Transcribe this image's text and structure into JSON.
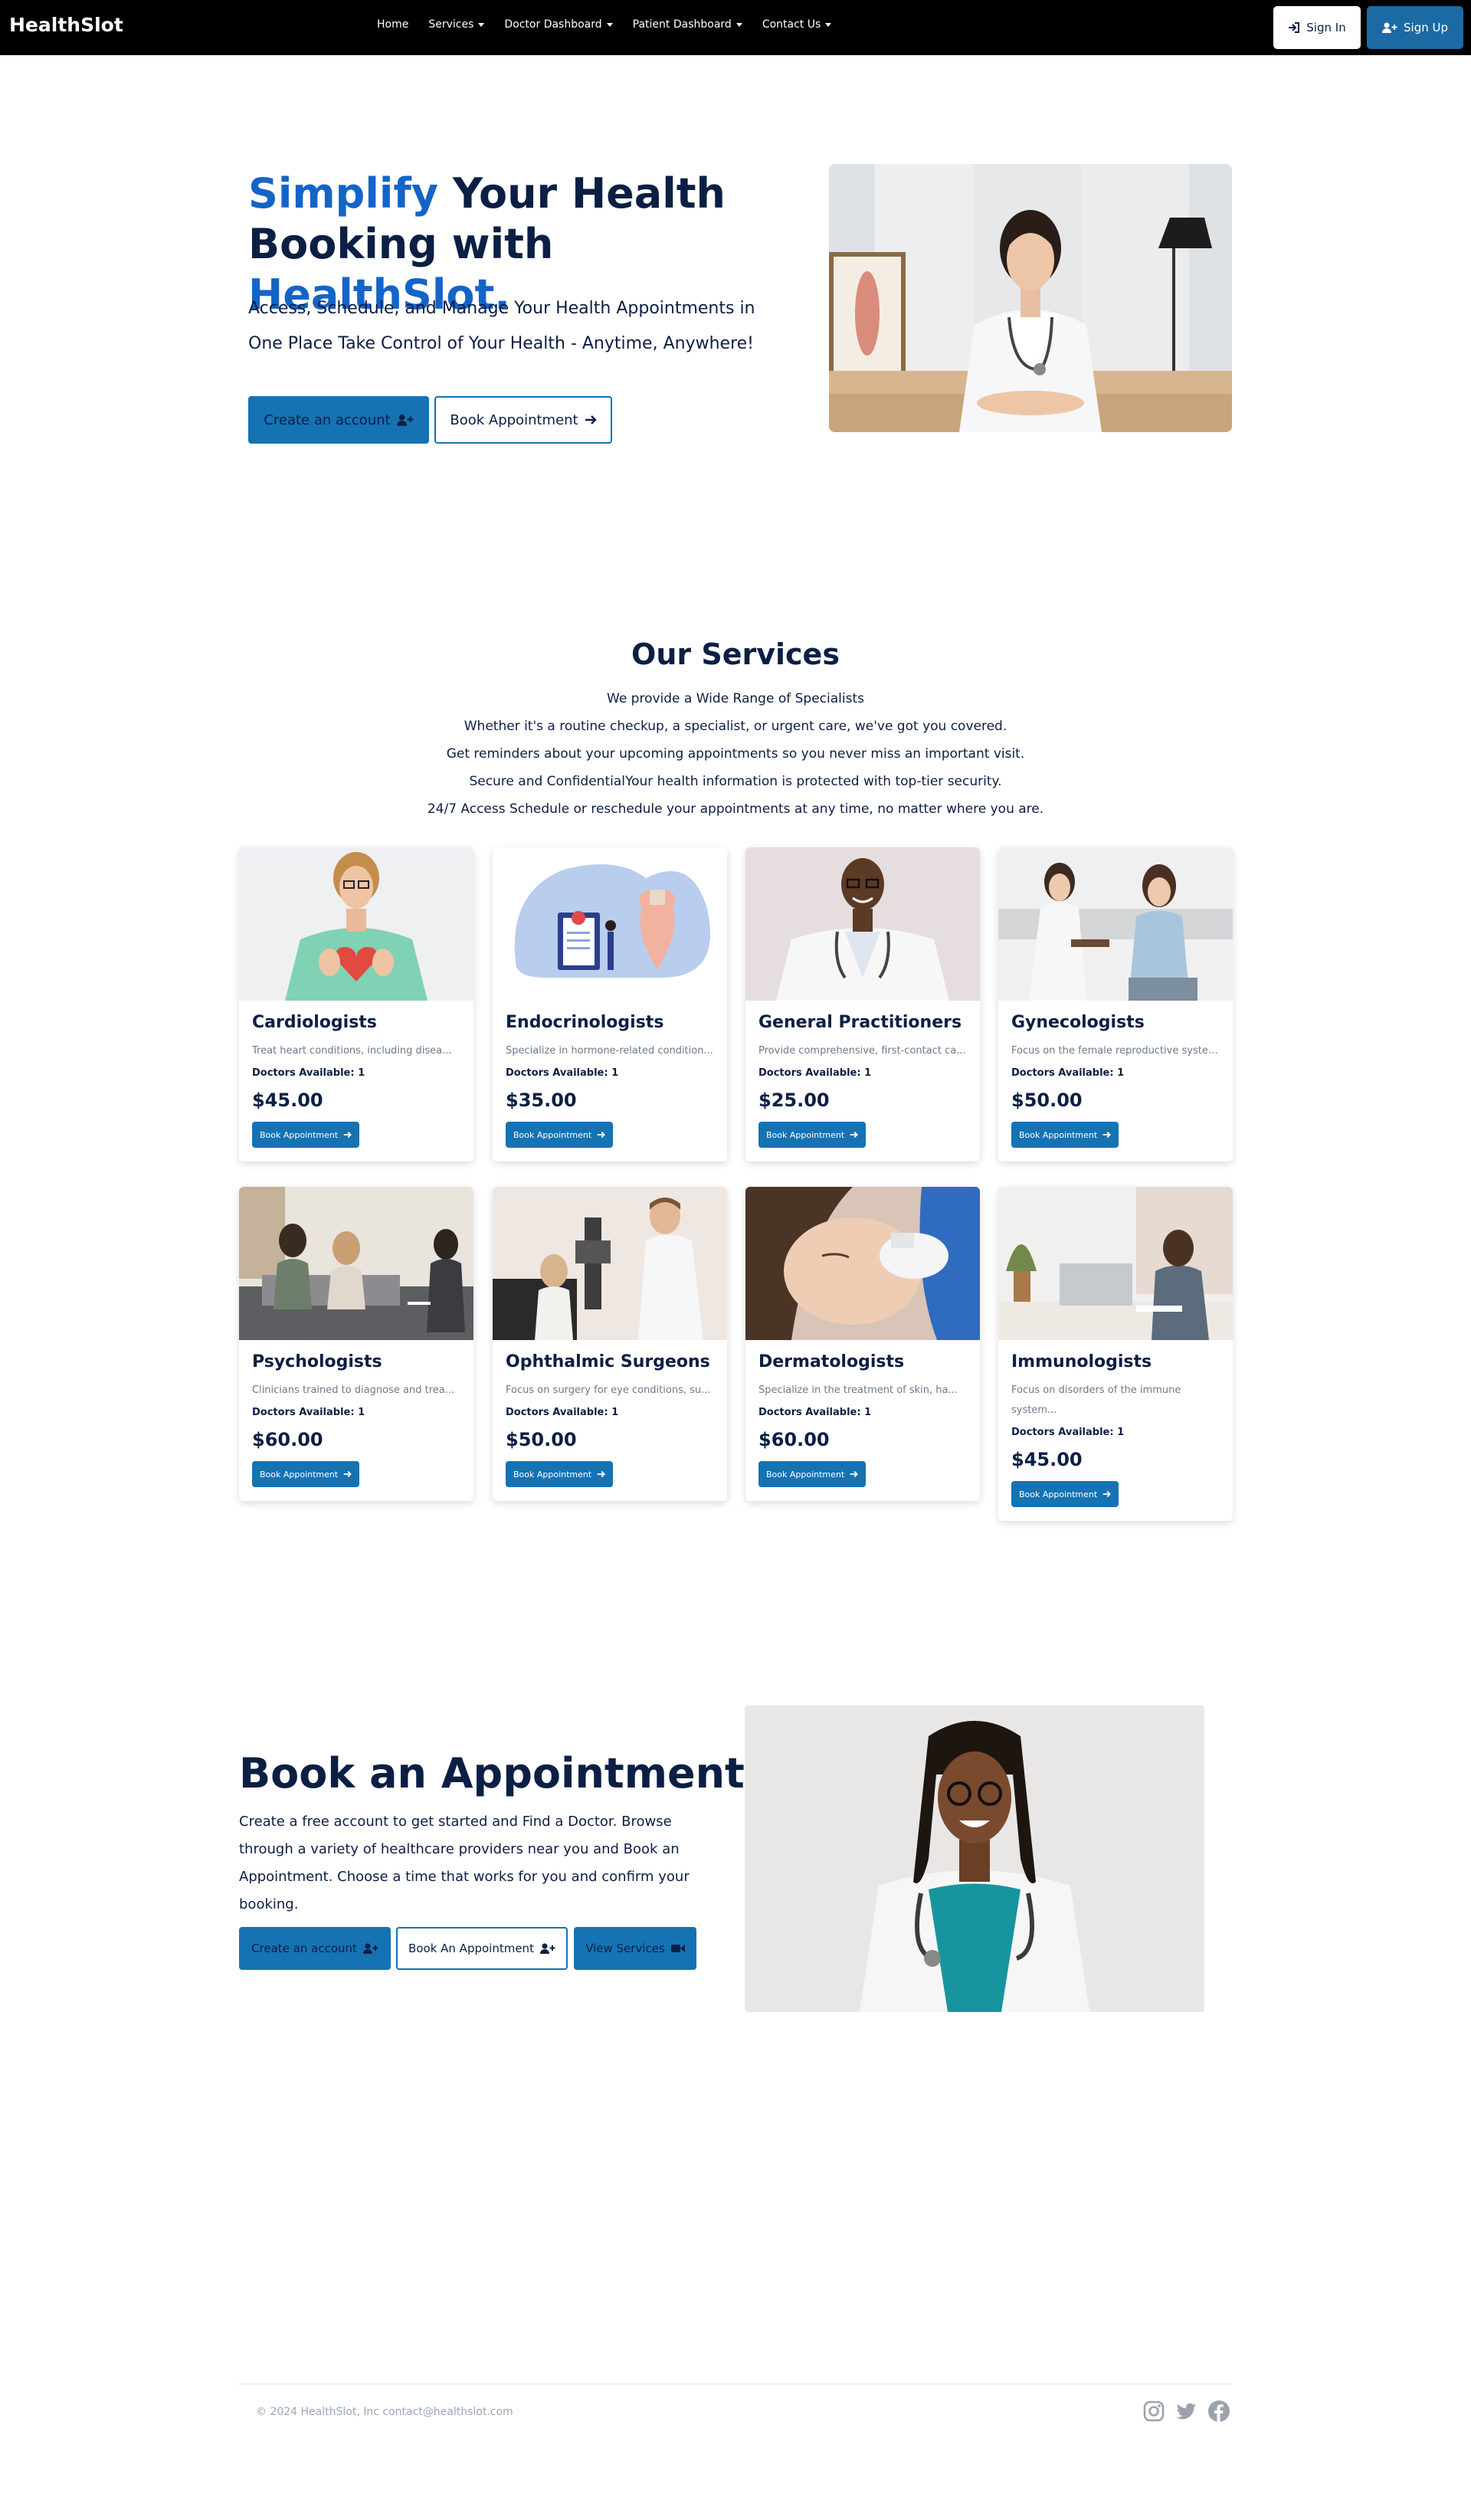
{
  "nav": {
    "brand": "HealthSlot",
    "links": [
      {
        "label": "Home"
      },
      {
        "label": "Services"
      },
      {
        "label": "Doctor Dashboard"
      },
      {
        "label": "Patient Dashboard"
      },
      {
        "label": "Contact Us"
      }
    ],
    "signin": "Sign In",
    "signup": "Sign Up"
  },
  "hero": {
    "title_part1": "Simplify",
    "title_part2": " Your Health",
    "title_part3": "Booking with ",
    "title_part4": "HealthSlot.",
    "subtitle": "Access, Schedule, and Manage Your Health Appointments in One Place Take Control of Your Health - Anytime, Anywhere!",
    "btn_create": "Create an account",
    "btn_book": "Book Appointment"
  },
  "services": {
    "title": "Our Services",
    "lines": [
      "We provide a Wide Range of Specialists",
      "Whether it's a routine checkup, a specialist, or urgent care, we've got you covered.",
      "Get reminders about your upcoming appointments so you never miss an important visit.",
      "Secure and ConfidentialYour health information is protected with top-tier security.",
      "24/7 Access Schedule or reschedule your appointments at any time, no matter where you are."
    ],
    "cards": [
      {
        "title": "Cardiologists",
        "desc": "Treat heart conditions, including disea...",
        "avail": "Doctors Available: 1",
        "price": "$45.00",
        "btn": "Book Appointment"
      },
      {
        "title": "Endocrinologists",
        "desc": "Specialize in hormone-related condition...",
        "avail": "Doctors Available: 1",
        "price": "$35.00",
        "btn": "Book Appointment"
      },
      {
        "title": "General Practitioners",
        "desc": "Provide comprehensive, first-contact ca...",
        "avail": "Doctors Available: 1",
        "price": "$25.00",
        "btn": "Book Appointment"
      },
      {
        "title": "Gynecologists",
        "desc": "Focus on the female reproductive system...",
        "avail": "Doctors Available: 1",
        "price": "$50.00",
        "btn": "Book Appointment"
      },
      {
        "title": "Psychologists",
        "desc": "Clinicians trained to diagnose and trea...",
        "avail": "Doctors Available: 1",
        "price": "$60.00",
        "btn": "Book Appointment"
      },
      {
        "title": "Ophthalmic Surgeons",
        "desc": "Focus on surgery for eye conditions, su...",
        "avail": "Doctors Available: 1",
        "price": "$50.00",
        "btn": "Book Appointment"
      },
      {
        "title": "Dermatologists",
        "desc": "Specialize in the treatment of skin, ha...",
        "avail": "Doctors Available: 1",
        "price": "$60.00",
        "btn": "Book Appointment"
      },
      {
        "title": "Immunologists",
        "desc": "Focus on disorders of the immune system...",
        "avail": "Doctors Available: 1",
        "price": "$45.00",
        "btn": "Book Appointment"
      }
    ]
  },
  "book": {
    "title": "Book an Appointment",
    "text": "Create a free account to get started and Find a Doctor. Browse through a variety of healthcare providers near you and Book an Appointment. Choose a time that works for you and confirm your booking.",
    "btn_create": "Create an account",
    "btn_book": "Book An Appointment",
    "btn_services": "View Services"
  },
  "footer": {
    "text": "© 2024 HealthSlot, Inc contact@healthslot.com"
  },
  "icons": {
    "signin": "sign-in-icon",
    "signup": "user-plus-icon",
    "arrow": "arrow-right-icon",
    "video": "video-icon",
    "instagram": "instagram-icon",
    "twitter": "twitter-icon",
    "facebook": "facebook-icon"
  },
  "colors": {
    "accent": "#1464c8",
    "primary": "#1573b3",
    "heading": "#0b1f44",
    "navbar": "#000000"
  }
}
